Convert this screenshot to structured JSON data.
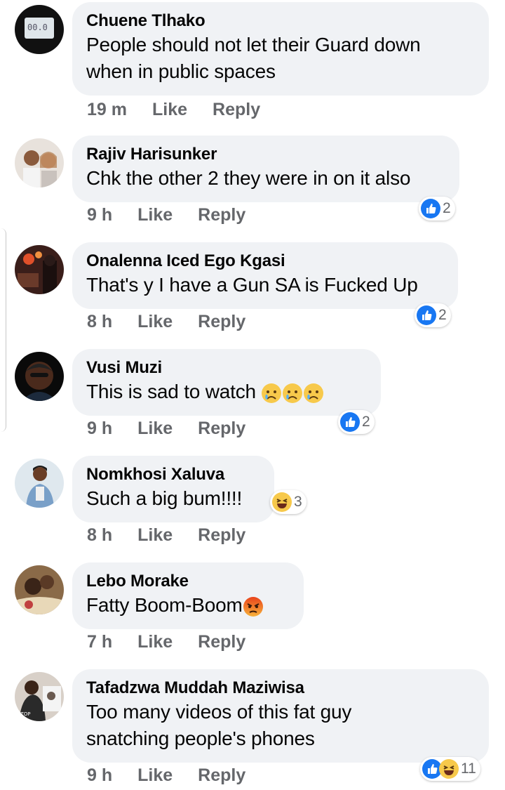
{
  "comments": [
    {
      "name": "Chuene Tlhako",
      "text": "People should not let their Guard down when in public spaces",
      "time": "19 m",
      "like": "Like",
      "reply": "Reply",
      "reaction_count": ""
    },
    {
      "name": "Rajiv Harisunker",
      "text": "Chk the other 2 they were in on it also",
      "time": "9 h",
      "like": "Like",
      "reply": "Reply",
      "reaction_count": "2"
    },
    {
      "name": "Onalenna Iced Ego Kgasi",
      "text": "That's y I have a Gun SA is Fucked Up",
      "time": "8 h",
      "like": "Like",
      "reply": "Reply",
      "reaction_count": "2"
    },
    {
      "name": "Vusi Muzi",
      "text": "This is sad to watch",
      "time": "9 h",
      "like": "Like",
      "reply": "Reply",
      "reaction_count": "2"
    },
    {
      "name": "Nomkhosi Xaluva",
      "text": "Such a big bum!!!!",
      "time": "8 h",
      "like": "Like",
      "reply": "Reply",
      "reaction_count": "3"
    },
    {
      "name": "Lebo Morake",
      "text": "Fatty Boom-Boom",
      "time": "7 h",
      "like": "Like",
      "reply": "Reply",
      "reaction_count": ""
    },
    {
      "name": "Tafadzwa Muddah Maziwisa",
      "text": "Too many videos of this fat guy snatching people's phones",
      "time": "9 h",
      "like": "Like",
      "reply": "Reply",
      "reaction_count": "11"
    }
  ],
  "colors": {
    "bubble": "#f0f2f5",
    "meta": "#65676b",
    "like_blue": "#1877f2",
    "haha_yellow": "#f7c94b",
    "angry_orange": "#e9710f"
  },
  "icons": {
    "like": "like-icon",
    "haha": "haha-icon",
    "sad": "sad-icon",
    "angry": "angry-icon"
  }
}
